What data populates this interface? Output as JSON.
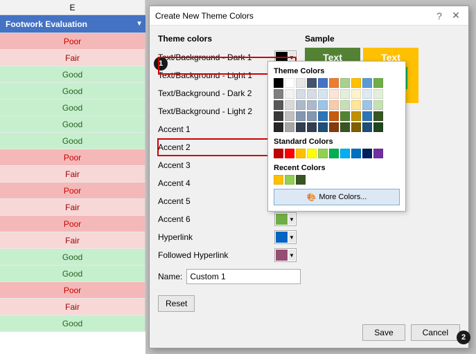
{
  "spreadsheet": {
    "col_header": "E",
    "title_row": "Footwork Evaluation",
    "rows": [
      {
        "label": "Poor",
        "class": "row-poor"
      },
      {
        "label": "Fair",
        "class": "row-fair"
      },
      {
        "label": "Good",
        "class": "row-good"
      },
      {
        "label": "Good",
        "class": "row-good"
      },
      {
        "label": "Good",
        "class": "row-good"
      },
      {
        "label": "Good",
        "class": "row-good"
      },
      {
        "label": "Good",
        "class": "row-good"
      },
      {
        "label": "Poor",
        "class": "row-poor"
      },
      {
        "label": "Fair",
        "class": "row-fair"
      },
      {
        "label": "Poor",
        "class": "row-poor"
      },
      {
        "label": "Fair",
        "class": "row-fair"
      },
      {
        "label": "Poor",
        "class": "row-poor"
      },
      {
        "label": "Fair",
        "class": "row-fair"
      },
      {
        "label": "Good",
        "class": "row-good"
      },
      {
        "label": "Good",
        "class": "row-good"
      },
      {
        "label": "Poor",
        "class": "row-poor"
      },
      {
        "label": "Fair",
        "class": "row-fair"
      },
      {
        "label": "Good",
        "class": "row-good"
      }
    ]
  },
  "dialog": {
    "title": "Create New Theme Colors",
    "help_btn": "?",
    "close_btn": "✕",
    "theme_colors_label": "Theme colors",
    "sample_label": "Sample",
    "rows": [
      {
        "label": "Text/Background - Dark 1",
        "underline_start": 5,
        "color": "#000000"
      },
      {
        "label": "Text/Background - Light 1",
        "color": "#ffffff"
      },
      {
        "label": "Text/Background - Dark 2",
        "color": "#44546a"
      },
      {
        "label": "Text/Background - Light 2",
        "color": "#e7e6e6"
      },
      {
        "label": "Accent 1",
        "color": "#4472c4"
      },
      {
        "label": "Accent 2",
        "color": "#9b2ec4",
        "highlighted": true
      },
      {
        "label": "Accent 3",
        "color": "#a9d18e"
      },
      {
        "label": "Accent 4",
        "color": "#ffc000"
      },
      {
        "label": "Accent 5",
        "color": "#5b9bd5"
      },
      {
        "label": "Accent 6",
        "color": "#70ad47"
      },
      {
        "label": "Hyperlink",
        "color": "#0563c1"
      },
      {
        "label": "Followed Hyperlink",
        "color": "#954f72"
      }
    ],
    "name_label": "Name:",
    "name_value": "Custom 1",
    "reset_label": "Reset",
    "save_label": "Save",
    "cancel_label": "Cancel"
  },
  "color_picker": {
    "theme_colors_label": "Theme Colors",
    "standard_colors_label": "Standard Colors",
    "recent_colors_label": "Recent Colors",
    "more_colors_label": "More Colors...",
    "theme_rows": [
      [
        "#000000",
        "#ffffff",
        "#e7e6e6",
        "#44546a",
        "#4472c4",
        "#ed7d31",
        "#a9d18e",
        "#ffc000",
        "#5b9bd5",
        "#70ad47"
      ],
      [
        "#7f7f7f",
        "#f2f2f2",
        "#d6dce4",
        "#d6dce4",
        "#d6e4f0",
        "#fce4d6",
        "#e2efda",
        "#fff2cc",
        "#deeaf1",
        "#e2efda"
      ],
      [
        "#595959",
        "#d9d9d9",
        "#adb9ca",
        "#adb9ca",
        "#9dc3e6",
        "#f8cbad",
        "#c6e0b4",
        "#ffe699",
        "#9dc3e6",
        "#c6e0b4"
      ],
      [
        "#3a3a3a",
        "#bfbfbf",
        "#8497b0",
        "#8497b0",
        "#2e75b6",
        "#c55a11",
        "#548235",
        "#bf9000",
        "#2e75b6",
        "#375623"
      ],
      [
        "#262626",
        "#a6a6a6",
        "#333f4f",
        "#333f4f",
        "#1f4e79",
        "#843c0c",
        "#375623",
        "#7f6000",
        "#1f4e79",
        "#1e4620"
      ]
    ],
    "standard_colors": [
      "#c00000",
      "#ff0000",
      "#ffc000",
      "#ffff00",
      "#92d050",
      "#00b050",
      "#00b0f0",
      "#0070c0",
      "#002060",
      "#7030a0"
    ],
    "recent_colors": [
      "#ffc000",
      "#92d050",
      "#375623"
    ],
    "colors_more_label": "Colors \""
  },
  "badges": {
    "badge1": "1",
    "badge2": "2"
  }
}
